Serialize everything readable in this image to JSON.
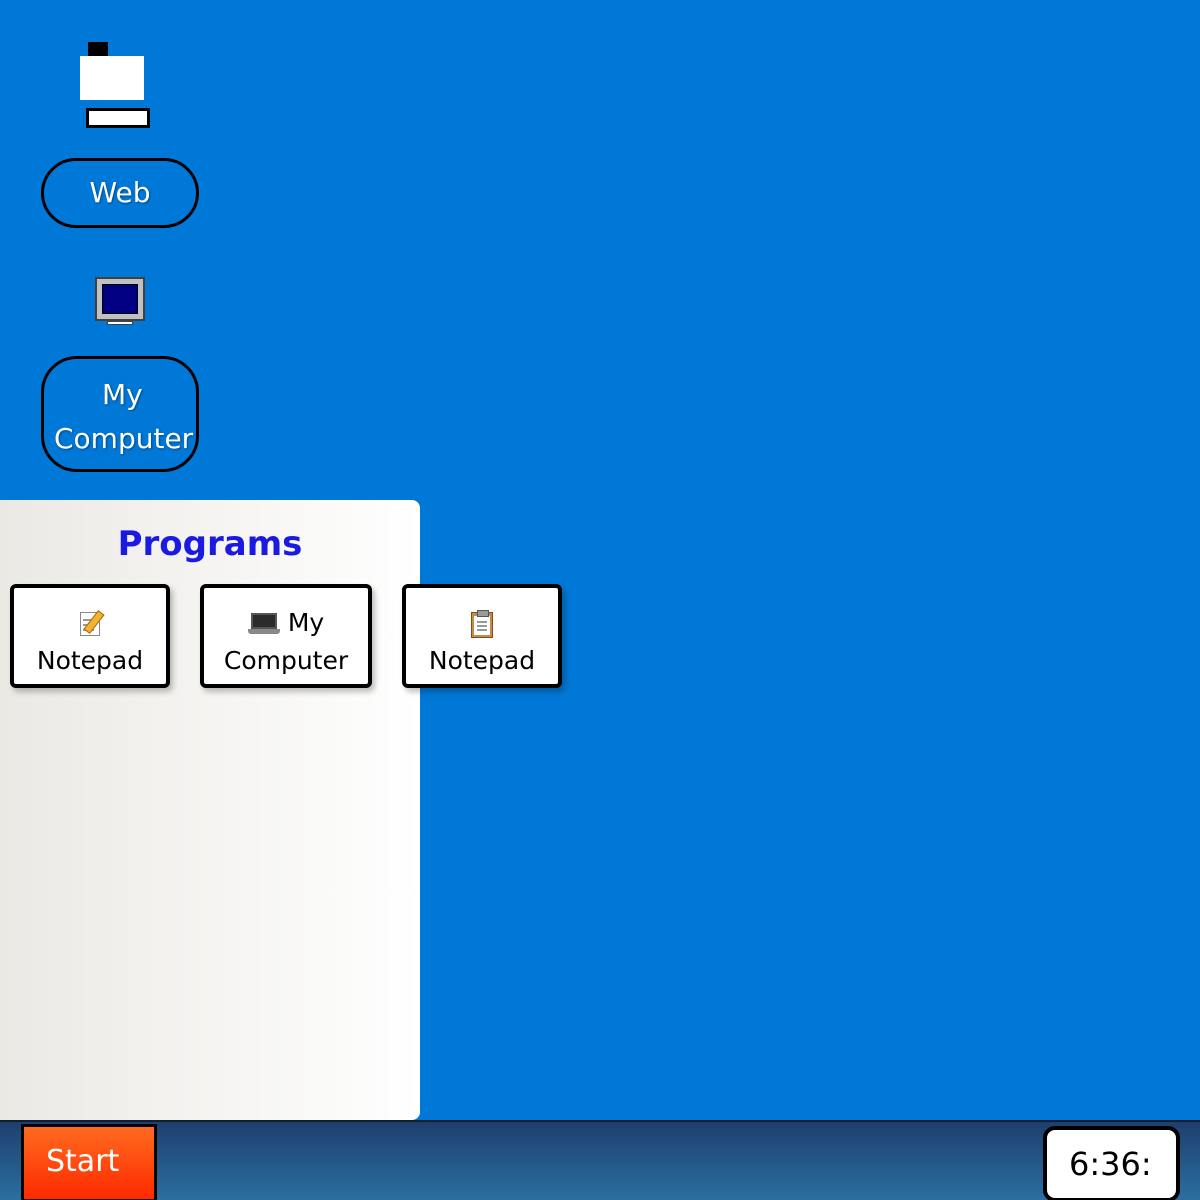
{
  "desktop": {
    "background_color": "#0078d7",
    "icons": [
      {
        "label": "Web",
        "icon": "web-icon"
      },
      {
        "label_line1": "My",
        "label_line2": "Computer",
        "icon": "monitor-icon"
      }
    ]
  },
  "start_menu": {
    "title": "Programs",
    "title_color": "#1a1ae0",
    "tiles": [
      {
        "label": "Notepad",
        "icon": "notepad-pencil-icon"
      },
      {
        "label_line1": "My",
        "label_line2": "Computer",
        "icon": "laptop-icon"
      },
      {
        "label": "Notepad",
        "icon": "clipboard-icon"
      }
    ]
  },
  "taskbar": {
    "start_label": "Start",
    "start_color": "#ff3d00",
    "clock": "6:36:"
  }
}
